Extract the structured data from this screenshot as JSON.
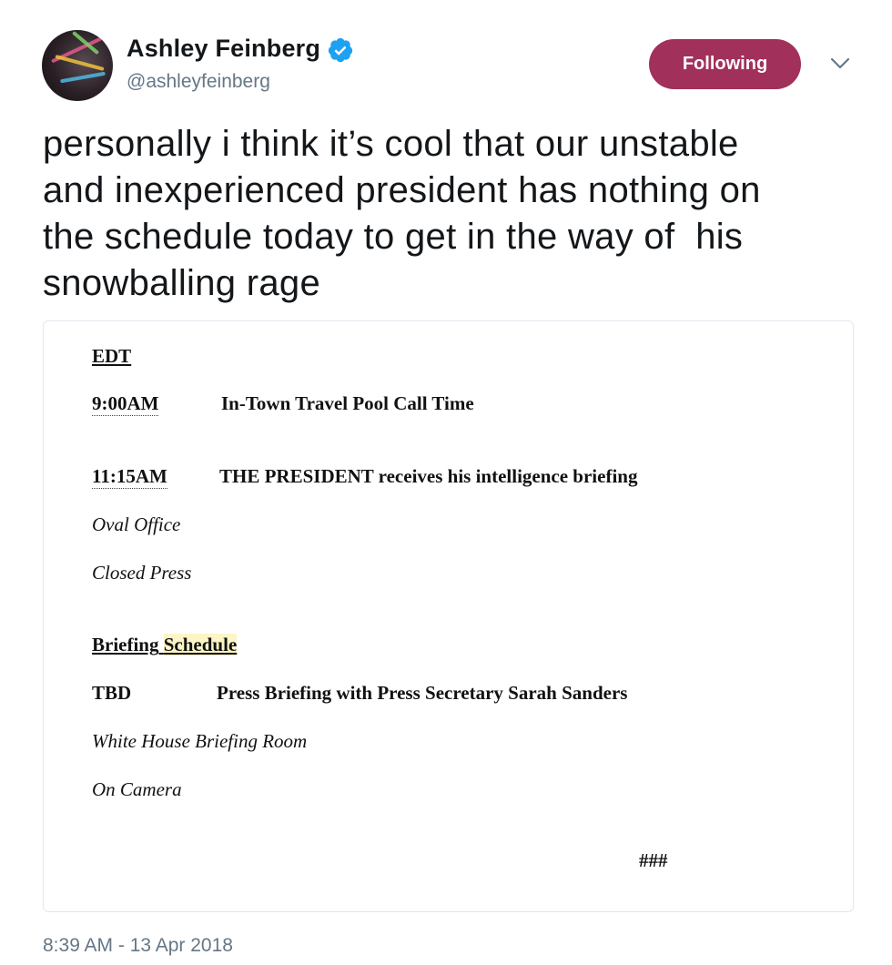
{
  "header": {
    "name": "Ashley Feinberg",
    "handle": "@ashleyfeinberg",
    "follow_label": "Following",
    "verified_icon": "verified-badge-icon",
    "menu_icon": "chevron-down-icon",
    "accent_color": "#a1315a"
  },
  "tweet": {
    "lines": [
      "personally i think it’s cool that our unstable",
      "and inexperienced president has nothing on",
      "the schedule today to get in the way of  his",
      "snowballing rage"
    ]
  },
  "schedule": {
    "edt": "EDT",
    "item1": {
      "time": "9:00AM",
      "desc": "In-Town Travel Pool Call Time"
    },
    "item2": {
      "time": "11:15AM",
      "desc": "THE PRESIDENT receives his intelligence briefing",
      "location": "Oval Office",
      "coverage": "Closed Press"
    },
    "briefing_word": "Briefing",
    "schedule_word": "Schedule",
    "item3": {
      "time": "TBD",
      "desc": "Press Briefing with Press Secretary Sarah Sanders",
      "location": "White House Briefing Room",
      "coverage": "On Camera"
    },
    "end": "###"
  },
  "footer": {
    "timestamp": "8:39 AM - 13 Apr 2018"
  }
}
